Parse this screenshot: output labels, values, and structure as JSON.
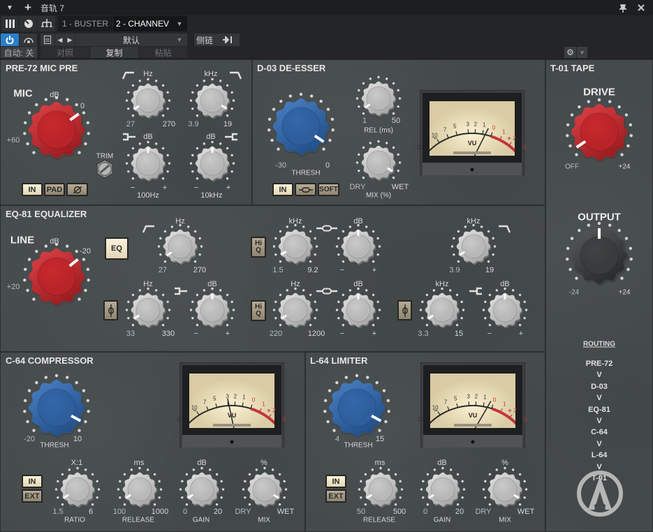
{
  "window": {
    "title": "音轨 7",
    "tabs": [
      {
        "label": "1 - BUSTER",
        "active": false
      },
      {
        "label": "2 - CHANNEV",
        "active": true
      }
    ],
    "preset": "默认",
    "sidechain": "侧链",
    "auto": "自动: 关",
    "compare": "对照",
    "copy": "复制",
    "paste": "粘贴",
    "accent": "#2a7fc9"
  },
  "pre72": {
    "title": "PRE-72 MIC PRE",
    "mic_label": "MIC",
    "mic_unit": "dB",
    "mic_max": "0",
    "mic_min": "+60",
    "trim": "TRIM",
    "hpf": {
      "unit": "Hz",
      "min": "27",
      "max": "270"
    },
    "lpf": {
      "unit": "kHz",
      "min": "3.9",
      "max": "19"
    },
    "low": {
      "unit": "dB",
      "minus": "−",
      "plus": "+",
      "name": "100Hz"
    },
    "high": {
      "unit": "dB",
      "minus": "−",
      "plus": "+",
      "name": "10kHz"
    },
    "buttons": {
      "in": "IN",
      "pad": "PAD"
    },
    "knobs": {
      "mic": 0.7,
      "hpf": 0.05,
      "lpf": 0.94,
      "low": 0.5,
      "high": 0.5
    }
  },
  "d03": {
    "title": "D-03 DE-ESSER",
    "thresh_min": "-30",
    "thresh_max": "0",
    "thresh": "THRESH",
    "rel_min": "1",
    "rel_max": "50",
    "rel": "REL (ms)",
    "mix_min": "DRY",
    "mix_max": "WET",
    "mix": "MIX (%)",
    "buttons": {
      "in": "IN",
      "soft": "SOFT"
    },
    "knobs": {
      "thresh": 0.96,
      "rel": 0.04,
      "mix": 0.95
    },
    "meter_vu": -0.5
  },
  "eq81": {
    "title": "EQ-81 EQUALIZER",
    "line_label": "LINE",
    "line_unit": "dB",
    "line_max": "-20",
    "line_min": "+20",
    "eq_button": "EQ",
    "hiq": "Hi Q",
    "hpf": {
      "unit": "Hz",
      "min": "27",
      "max": "270"
    },
    "hmf": {
      "unit": "kHz",
      "min": "1.5",
      "max": "9.2"
    },
    "hmf_gain": {
      "unit": "dB",
      "minus": "−",
      "plus": "+"
    },
    "lpf": {
      "unit": "kHz",
      "min": "3.9",
      "max": "19"
    },
    "low": {
      "unit": "Hz",
      "min": "33",
      "max": "330"
    },
    "low_gain": {
      "unit": "dB",
      "minus": "−",
      "plus": "+"
    },
    "lmf": {
      "unit": "Hz",
      "min": "220",
      "max": "1200"
    },
    "lmf_gain": {
      "unit": "dB",
      "minus": "−",
      "plus": "+"
    },
    "high": {
      "unit": "kHz",
      "min": "3.3",
      "max": "15"
    },
    "high_gain": {
      "unit": "dB",
      "minus": "−",
      "plus": "+"
    },
    "knobs": {
      "line": 0.69,
      "hpf": 0.04,
      "hmf": 0.06,
      "hmf_gain": 0.5,
      "lpf": 0.05,
      "low": 0.05,
      "low_gain": 0.5,
      "lmf": 0.05,
      "lmf_gain": 0.5,
      "high": 0.05,
      "high_gain": 0.5
    }
  },
  "c64": {
    "title": "C-64 COMPRESSOR",
    "thresh_min": "-20",
    "thresh_max": "10",
    "thresh": "THRESH",
    "buttons": {
      "in": "IN",
      "ext": "EXT"
    },
    "ratio": {
      "unit": "X:1",
      "min": "1.5",
      "max": "6",
      "name": "RATIO"
    },
    "release": {
      "unit": "ms",
      "min": "100",
      "max": "1000",
      "name": "RELEASE"
    },
    "gain": {
      "unit": "dB",
      "min": "0",
      "max": "20",
      "name": "GAIN"
    },
    "mix": {
      "unit": "%",
      "min": "DRY",
      "max": "WET",
      "name": "MIX"
    },
    "knobs": {
      "thresh": 0.94,
      "ratio": 0.05,
      "release": 0.05,
      "gain": 0.05,
      "mix": 0.95
    },
    "meter_vu": -3
  },
  "l64": {
    "title": "L-64 LIMITER",
    "thresh_min": "4",
    "thresh_max": "15",
    "thresh": "THRESH",
    "buttons": {
      "in": "IN",
      "ext": "EXT"
    },
    "release": {
      "unit": "ms",
      "min": "50",
      "max": "500",
      "name": "RELEASE"
    },
    "gain": {
      "unit": "dB",
      "min": "0",
      "max": "20",
      "name": "GAIN"
    },
    "mix": {
      "unit": "%",
      "min": "DRY",
      "max": "WET",
      "name": "MIX"
    },
    "knobs": {
      "thresh": 0.94,
      "release": 0.05,
      "gain": 0.05,
      "mix": 0.95
    },
    "meter_vu": -0.3
  },
  "t01": {
    "title": "T-01 TAPE",
    "drive": "DRIVE",
    "drive_min": "OFF",
    "drive_max": "+24",
    "output": "OUTPUT",
    "output_min": "-24",
    "output_max": "+24",
    "knobs": {
      "drive": 0.04,
      "output": 0.5
    },
    "routing_title": "ROUTING",
    "routing": [
      "PRE-72",
      "V",
      "D-03",
      "V",
      "EQ-81",
      "V",
      "C-64",
      "V",
      "L-64",
      "V",
      "T-01"
    ]
  },
  "meter": {
    "scale": [
      {
        "vu": -20,
        "label": "20"
      },
      {
        "vu": -10,
        "label": "10"
      },
      {
        "vu": -7,
        "label": "7"
      },
      {
        "vu": -5,
        "label": "5"
      },
      {
        "vu": -3,
        "label": "3"
      },
      {
        "vu": -2,
        "label": "2"
      },
      {
        "vu": -1,
        "label": "1"
      },
      {
        "vu": 0,
        "label": "0"
      },
      {
        "vu": 1,
        "label": "1"
      },
      {
        "vu": 2,
        "label": "2"
      },
      {
        "vu": 3,
        "label": "3"
      }
    ],
    "vu_label": "VU",
    "minus": "−",
    "plus": "+",
    "red": "#c4343a"
  },
  "colors": {
    "red": "#c42a2e",
    "blue": "#2f64a6",
    "grey": "#c4c4c4",
    "dark": "#3a3b3c"
  }
}
